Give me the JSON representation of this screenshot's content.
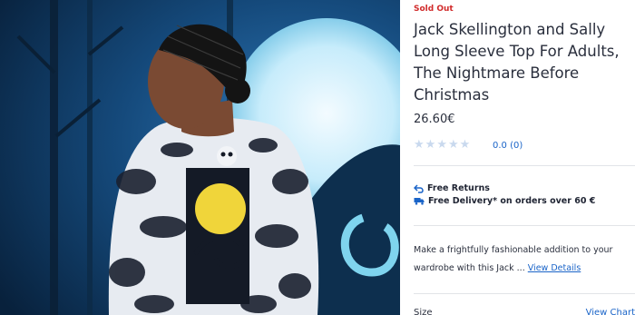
{
  "product": {
    "status_badge": "Sold Out",
    "title": "Jack Skellington and Sally Long Sleeve Top For Adults, The Nightmare Before Christmas",
    "price": "26.60€",
    "rating": {
      "stars": 0,
      "max_stars": 5,
      "text": "0.0 (0)"
    },
    "perks": {
      "returns": "Free Returns",
      "delivery": "Free Delivery* on orders over 60 €"
    },
    "description": "Make a frightfully fashionable addition to your wardrobe with this Jack ...",
    "view_details": "View Details",
    "size_label": "Size",
    "size_chart_link": "View Chart"
  },
  "icons": {
    "returns": "return-arrow-icon",
    "delivery": "delivery-truck-icon",
    "star": "star-icon"
  },
  "colors": {
    "sold_out": "#d12b2b",
    "link": "#1a64c8",
    "star_empty": "#c9d9ee"
  }
}
